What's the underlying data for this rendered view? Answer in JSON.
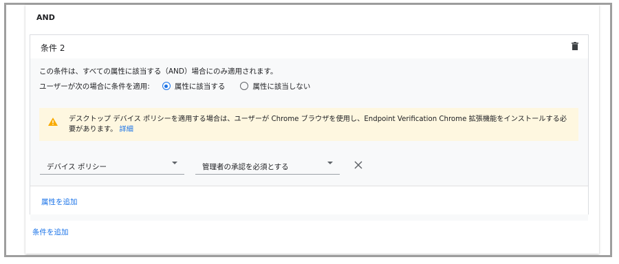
{
  "operator_label": "AND",
  "condition": {
    "title": "条件 2",
    "description": "この条件は、すべての属性に該当する（AND）場合にのみ適用されます。",
    "apply_label": "ユーザーが次の場合に条件を適用:",
    "radio_options": [
      {
        "label": "属性に該当する",
        "selected": true
      },
      {
        "label": "属性に該当しない",
        "selected": false
      }
    ],
    "warning": {
      "text": "デスクトップ デバイス ポリシーを適用する場合は、ユーザーが Chrome ブラウザを使用し、Endpoint Verification Chrome 拡張機能をインストールする必要があります。",
      "link_label": "詳細",
      "icon": "warning-icon",
      "color": "#f9ab00"
    },
    "attribute_select": {
      "value": "デバイス ポリシー"
    },
    "value_select": {
      "value": "管理者の承認を必須とする"
    },
    "add_attribute_label": "属性を追加"
  },
  "add_condition_label": "条件を追加",
  "colors": {
    "accent": "#1a73e8",
    "banner_bg": "#fef7e0"
  }
}
